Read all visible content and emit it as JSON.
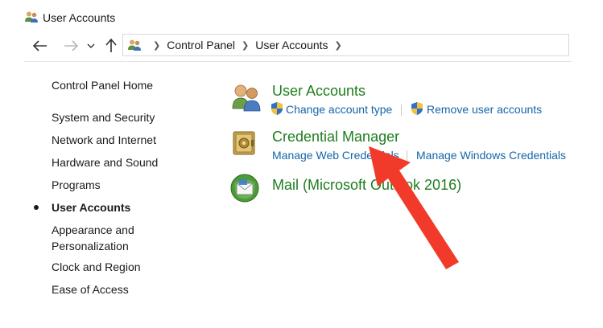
{
  "window": {
    "title": "User Accounts"
  },
  "breadcrumb": [
    "Control Panel",
    "User Accounts"
  ],
  "left_nav": {
    "home": "Control Panel Home",
    "items": [
      "System and Security",
      "Network and Internet",
      "Hardware and Sound",
      "Programs",
      "User Accounts",
      "Appearance and",
      "Personalization",
      "Clock and Region",
      "Ease of Access"
    ]
  },
  "categories": {
    "user_accounts": {
      "title": "User Accounts",
      "links": [
        "Change account type",
        "Remove user accounts"
      ]
    },
    "credential_manager": {
      "title": "Credential Manager",
      "links": [
        "Manage Web Credentials",
        "Manage Windows Credentials"
      ]
    },
    "mail": {
      "title": "Mail (Microsoft Outlook 2016)"
    }
  },
  "colors": {
    "category_title": "#1e7d1e",
    "link": "#1565a8",
    "annotation_arrow": "#f23a2b"
  },
  "icons": {
    "title": "users-icon",
    "back": "arrow-left-icon",
    "forward": "arrow-right-icon",
    "recent": "chevron-down-icon",
    "up": "arrow-up-icon",
    "user_accounts": "users-icon",
    "credential_manager": "vault-icon",
    "mail": "mail-icon",
    "uac": "uac-shield-icon"
  }
}
